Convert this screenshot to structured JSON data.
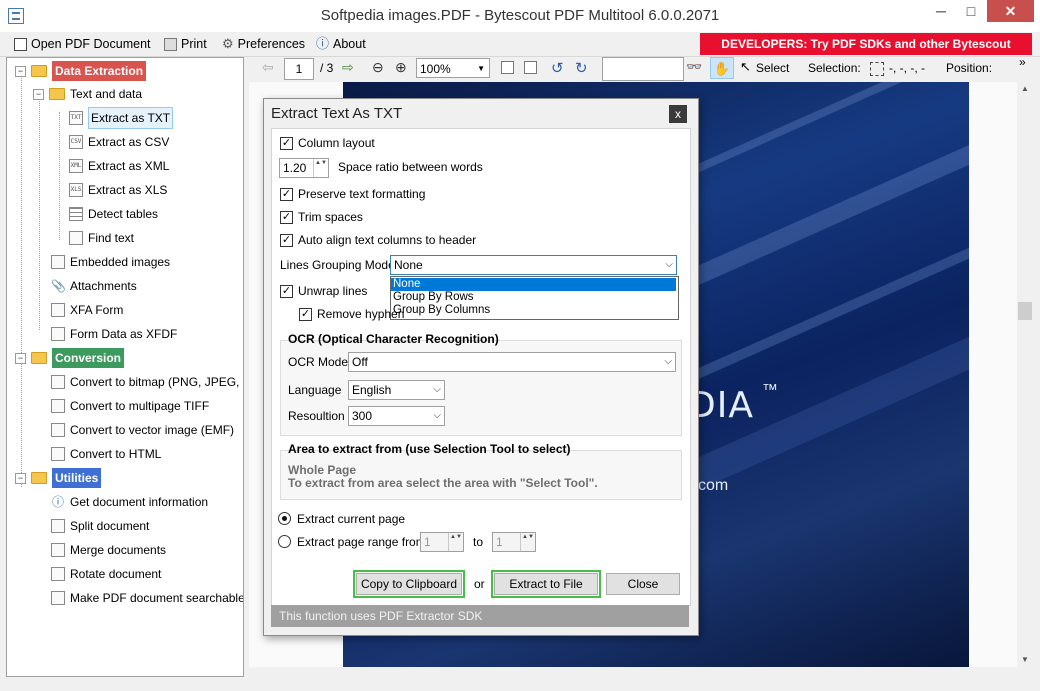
{
  "window": {
    "title": "Softpedia images.PDF - Bytescout PDF Multitool 6.0.0.2071",
    "min_glyph": "─",
    "max_glyph": "□",
    "close_glyph": "✕"
  },
  "menu": {
    "open": "Open PDF Document",
    "print": "Print",
    "preferences": "Preferences",
    "about": "About",
    "banner": "DEVELOPERS: Try PDF SDKs and other Bytescout products"
  },
  "tree": {
    "data_extraction": "Data Extraction",
    "text_and_data": "Text and data",
    "items_extract": [
      {
        "icon": "TXT",
        "label": "Extract as TXT"
      },
      {
        "icon": "CSV",
        "label": "Extract as CSV"
      },
      {
        "icon": "XML",
        "label": "Extract as XML"
      },
      {
        "icon": "XLS",
        "label": "Extract as XLS"
      },
      {
        "icon": "",
        "label": "Detect tables"
      },
      {
        "icon": "",
        "label": "Find text"
      }
    ],
    "embedded_images": "Embedded images",
    "attachments": "Attachments",
    "xfa_form": "XFA Form",
    "form_data": "Form Data as XFDF",
    "conversion": "Conversion",
    "conv_items": [
      "Convert to bitmap (PNG, JPEG, ...)",
      "Convert to multipage TIFF",
      "Convert to vector image (EMF)",
      "Convert to HTML"
    ],
    "utilities": "Utilities",
    "util_items": [
      "Get document information",
      "Split document",
      "Merge documents",
      "Rotate document",
      "Make PDF document searchable"
    ]
  },
  "viewer": {
    "page_current": "1",
    "page_total": "/ 3",
    "zoom": "100%",
    "select_label": "Select",
    "selection_label": "Selection:",
    "selection_value": "-, -, -, -",
    "position_label": "Position:",
    "overflow": "»"
  },
  "pdf": {
    "logo_fragment": "DIA",
    "tm": "™",
    "domain_fragment": "com"
  },
  "dialog": {
    "title": "Extract Text As TXT",
    "close_glyph": "x",
    "column_layout": "Column layout",
    "space_ratio_value": "1.20",
    "space_ratio_label": "Space ratio between words",
    "preserve": "Preserve text formatting",
    "trim": "Trim spaces",
    "auto_align": "Auto align text columns to header",
    "lines_grouping_label": "Lines Grouping Mode",
    "lines_grouping_value": "None",
    "lines_grouping_options": [
      "None",
      "Group By Rows",
      "Group By Columns"
    ],
    "unwrap": "Unwrap lines",
    "remove_hyphen": "Remove hyphen",
    "ocr_title": "OCR (Optical Character Recognition)",
    "ocr_mode_label": "OCR Mode",
    "ocr_mode_value": "Off",
    "language_label": "Language",
    "language_value": "English",
    "resolution_label": "Resoultion",
    "resolution_value": "300",
    "area_title": "Area to extract from (use Selection Tool to select)",
    "area_line1": "Whole Page",
    "area_line2": "To extract from area select the area with \"Select Tool\".",
    "extract_current": "Extract current page",
    "extract_range": "Extract page range from",
    "range_from": "1",
    "range_to_label": "to",
    "range_to": "1",
    "copy_btn": "Copy to Clipboard",
    "or_label": "or",
    "file_btn": "Extract to File",
    "close_btn": "Close",
    "footer": "This function uses PDF Extractor SDK"
  },
  "glyphs": {
    "check": "✓",
    "spin": "▲▼",
    "dropdown": "⌵",
    "minus": "−",
    "binoculars": "👓",
    "hand": "✋",
    "cursor": "↖"
  }
}
